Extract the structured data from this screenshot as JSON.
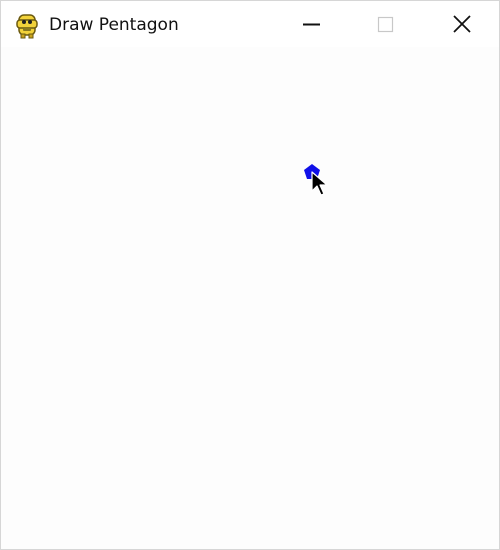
{
  "window": {
    "title": "Draw Pentagon",
    "app_icon": "python-snake-icon",
    "controls": {
      "minimize_icon": "minimize-icon",
      "maximize_icon": "maximize-icon",
      "close_icon": "close-icon"
    }
  },
  "canvas": {
    "background_color": "#fdfdfd",
    "shape": {
      "kind": "pentagon",
      "fill_color": "#1010e8"
    },
    "cursor_icon": "arrow-cursor-icon"
  }
}
